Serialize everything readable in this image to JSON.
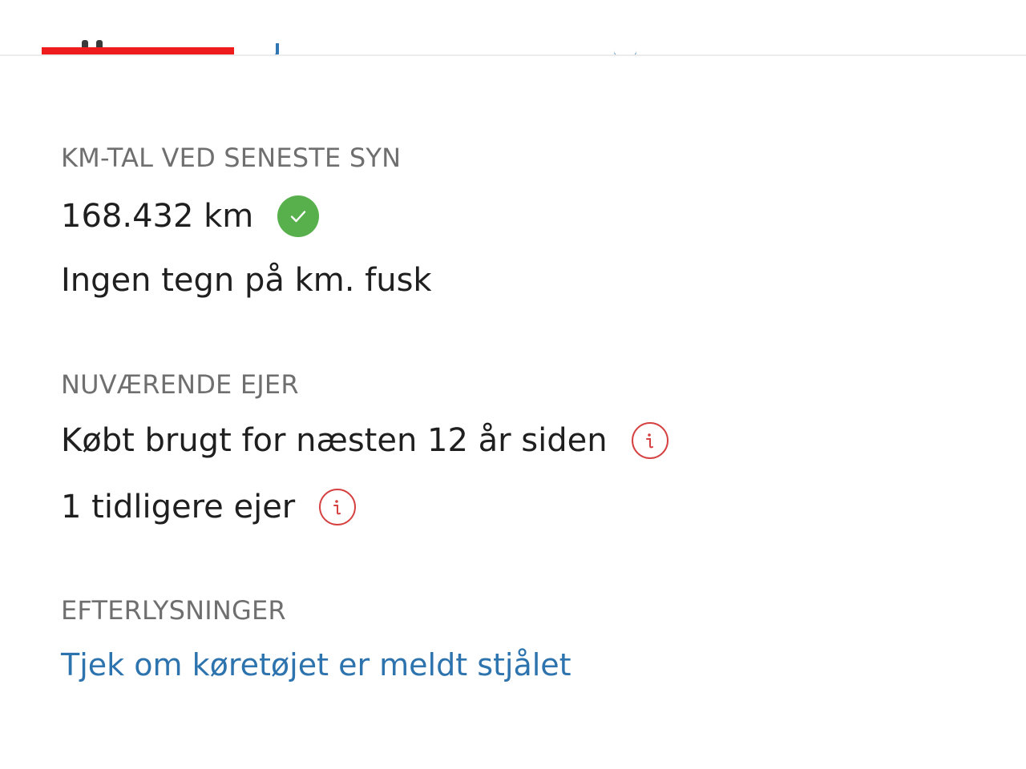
{
  "tabs": {
    "active_indicator_color": "#ee1c1c"
  },
  "mileage": {
    "label": "KM-TAL VED SENESTE SYN",
    "value": "168.432 km",
    "status_icon": "check-circle-icon",
    "note": "Ingen tegn på km. fusk"
  },
  "owner": {
    "label": "NUVÆRENDE EJER",
    "purchase_info": "Købt brugt for næsten 12 år siden",
    "previous_owners": "1 tidligere ejer",
    "info_icon": "info-icon"
  },
  "wanted": {
    "label": "EFTERLYSNINGER",
    "check_link": "Tjek om køretøjet er meldt stjålet"
  },
  "colors": {
    "label_gray": "#6f6f6f",
    "text_dark": "#1f1f1f",
    "link_blue": "#2d73ae",
    "success_green": "#58b04c",
    "info_red": "#d64141"
  }
}
